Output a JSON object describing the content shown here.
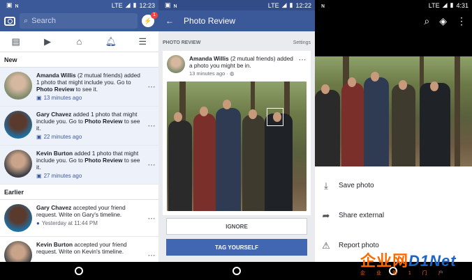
{
  "screen1": {
    "status": {
      "network": "LTE",
      "time": "12:23"
    },
    "search_placeholder": "Search",
    "messenger_badge": "1",
    "section_new": "New",
    "section_earlier": "Earlier",
    "notifications_new": [
      {
        "name": "Amanda Willis",
        "rest": " (2 mutual friends) added 1 photo that might include you. Go to ",
        "link": "Photo Review",
        "end": " to see it.",
        "time": "13 minutes ago"
      },
      {
        "name": "Gary Chavez",
        "rest": " added 1 photo that might include you. Go to ",
        "link": "Photo Review",
        "end": " to see it.",
        "time": "22 minutes ago"
      },
      {
        "name": "Kevin Burton",
        "rest": " added 1 photo that might include you. Go to ",
        "link": "Photo Review",
        "end": " to see it.",
        "time": "27 minutes ago"
      }
    ],
    "notifications_earlier": [
      {
        "name": "Gary Chavez",
        "rest": " accepted your friend request. Write on Gary's timeline.",
        "time": "Yesterday at 11:44 PM"
      },
      {
        "name": "Kevin Burton",
        "rest": " accepted your friend request. Write on Kevin's timeline.",
        "time": ""
      }
    ]
  },
  "screen2": {
    "status": {
      "network": "LTE",
      "time": "12:22"
    },
    "title": "Photo Review",
    "section_label": "PHOTO REVIEW",
    "settings_label": "Settings",
    "post": {
      "name": "Amanda Willis",
      "text": " (2 mutual friends) added a photo you might be in.",
      "time": "13 minutes ago ·"
    },
    "ignore_label": "IGNORE",
    "tag_label": "TAG YOURSELF"
  },
  "screen3": {
    "status": {
      "network": "LTE",
      "time": "4:31"
    },
    "menu": [
      {
        "label": "Save photo",
        "icon": "download-icon"
      },
      {
        "label": "Share external",
        "icon": "share-icon"
      },
      {
        "label": "Report photo",
        "icon": "report-icon"
      }
    ]
  },
  "watermark": {
    "main_a": "企业网",
    "main_b": "D1Net",
    "sub": "企 业 第 1 门 户"
  },
  "colors": {
    "facebook_blue": "#3b5998",
    "button_blue": "#4267b2",
    "unread_bg": "#edf2fa"
  }
}
